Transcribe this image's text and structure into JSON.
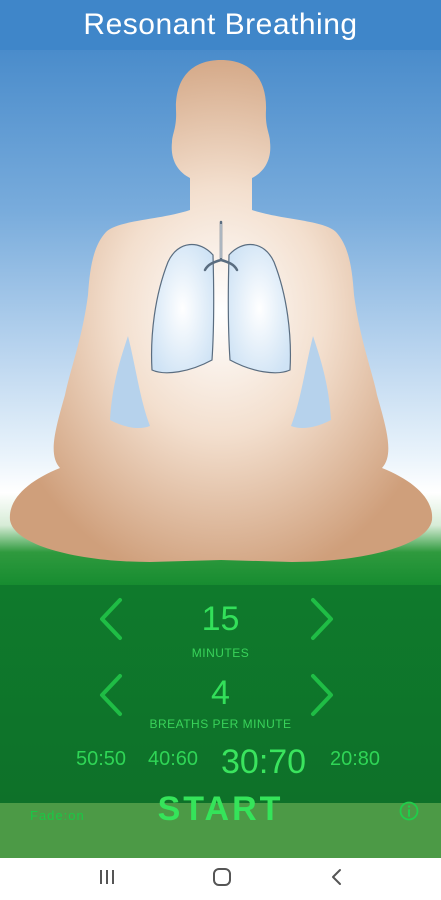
{
  "app": {
    "title": "Resonant Breathing"
  },
  "session": {
    "minutes_value": "15",
    "minutes_label": "MINUTES",
    "breaths_value": "4",
    "breaths_label": "BREATHS PER MINUTE"
  },
  "ratios": {
    "options": [
      "50:50",
      "40:60",
      "30:70",
      "20:80"
    ],
    "selected": "30:70"
  },
  "actions": {
    "start_label": "START",
    "fade_label": "Fade:on"
  },
  "colors": {
    "accent_green": "#33e05a",
    "header_blue": "#3f86c9",
    "body_tan": "#d3a581"
  },
  "icons": [
    "chevron-left-icon",
    "chevron-right-icon",
    "info-icon",
    "recents-icon",
    "home-icon",
    "back-icon"
  ]
}
